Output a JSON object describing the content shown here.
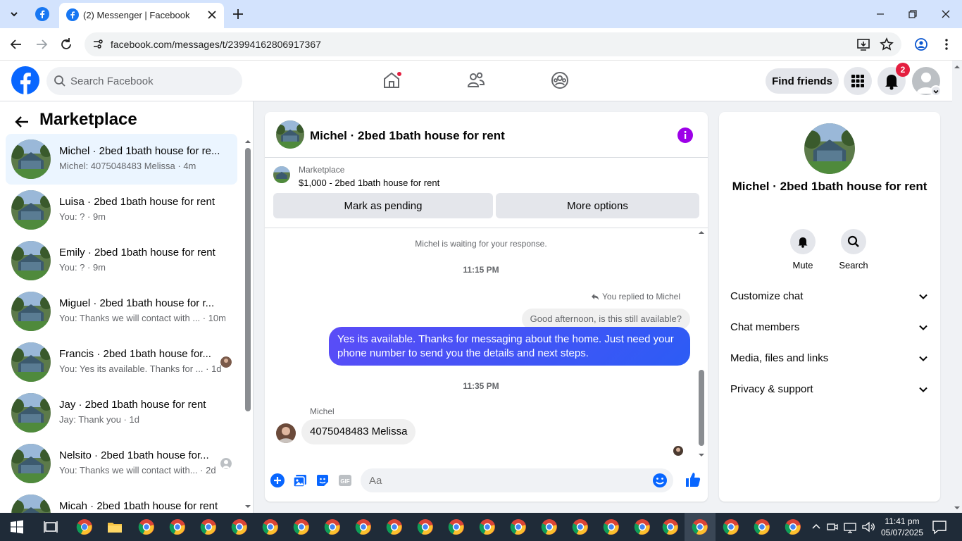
{
  "browser": {
    "tab_title": "(2) Messenger | Facebook",
    "url": "facebook.com/messages/t/23994162806917367"
  },
  "fb": {
    "search_placeholder": "Search Facebook",
    "find_friends": "Find friends",
    "notif_count": "2",
    "brand_color": "#1877f2"
  },
  "marketplace": {
    "title": "Marketplace",
    "conversations": [
      {
        "name": "Michel · 2bed 1bath house for re...",
        "preview": "Michel: 4075048483 Melissa · 4m",
        "active": true
      },
      {
        "name": "Luisa · 2bed 1bath house for rent",
        "preview": "You: ? · 9m"
      },
      {
        "name": "Emily · 2bed 1bath house for rent",
        "preview": "You: ? · 9m"
      },
      {
        "name": "Miguel · 2bed 1bath house for r...",
        "preview": "You: Thanks we will contact with ... · 10m"
      },
      {
        "name": "Francis · 2bed 1bath house for...",
        "preview": "You: Yes its available. Thanks for ... · 1d"
      },
      {
        "name": "Jay · 2bed 1bath house for rent",
        "preview": "Jay: Thank you · 1d"
      },
      {
        "name": "Nelsito · 2bed 1bath house for...",
        "preview": "You: Thanks we will contact with... · 2d"
      },
      {
        "name": "Micah · 2bed 1bath house for rent",
        "preview": ""
      }
    ]
  },
  "chat": {
    "title": "Michel · 2bed 1bath house for rent",
    "listing_label": "Marketplace",
    "listing_price": "$1,000 - 2bed 1bath house for rent",
    "mark_pending": "Mark as pending",
    "more_options": "More options",
    "waiting": "Michel is waiting for your response.",
    "time1": "11:15 PM",
    "replied_to": "You replied to Michel",
    "quoted": "Good afternoon, is this still available?",
    "outgoing": "Yes its available. Thanks for messaging about the home. Just need your phone number to send you the details and next steps.",
    "time2": "11:35 PM",
    "sender": "Michel",
    "incoming": "4075048483 Melissa",
    "composer_placeholder": "Aa"
  },
  "info": {
    "name": "Michel · 2bed 1bath house for rent",
    "mute": "Mute",
    "search": "Search",
    "rows": [
      "Customize chat",
      "Chat members",
      "Media, files and links",
      "Privacy & support"
    ]
  },
  "taskbar": {
    "time": "11:41 pm",
    "date": "05/07/2025"
  }
}
